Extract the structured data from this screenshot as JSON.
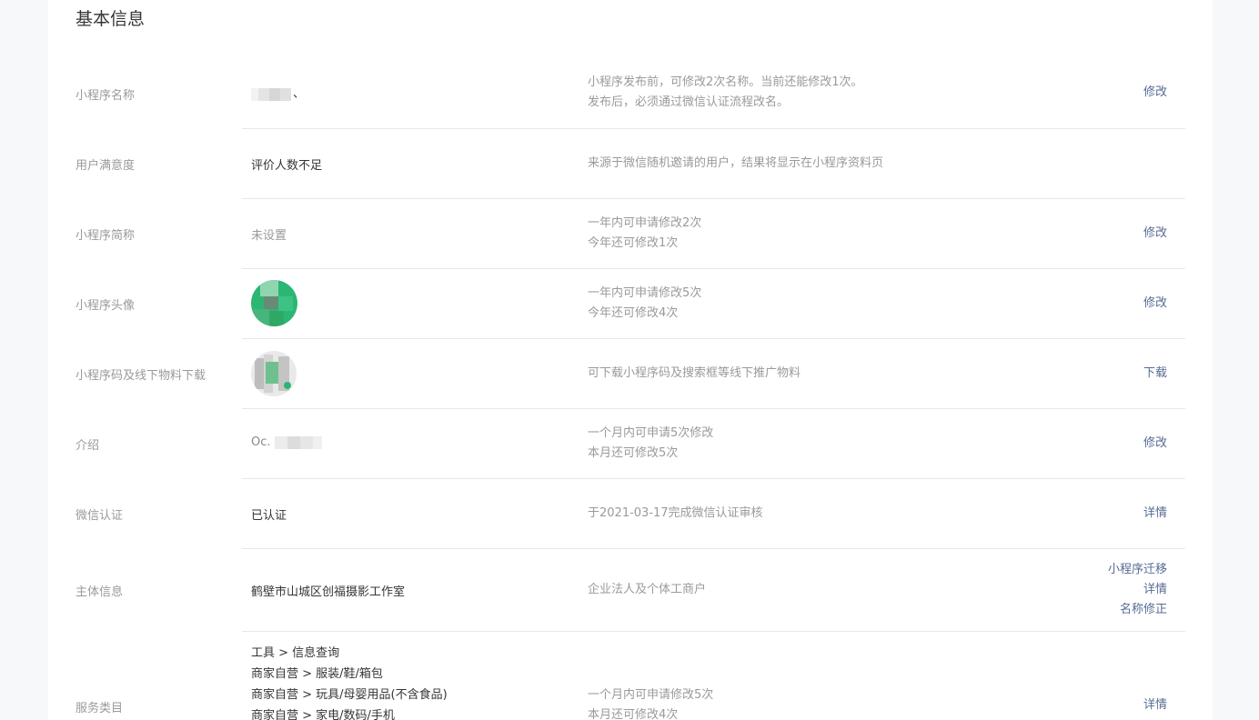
{
  "section_title": "基本信息",
  "rows": {
    "name": {
      "label": "小程序名称",
      "value_suffix": "、",
      "desc": [
        "小程序发布前，可修改2次名称。当前还能修改1次。",
        "发布后，必须通过微信认证流程改名。"
      ],
      "action": "修改"
    },
    "satisfaction": {
      "label": "用户满意度",
      "value": "评价人数不足",
      "desc": [
        "来源于微信随机邀请的用户，结果将显示在小程序资料页"
      ]
    },
    "short_name": {
      "label": "小程序简称",
      "value": "未设置",
      "desc": [
        "一年内可申请修改2次",
        "今年还可修改1次"
      ],
      "action": "修改"
    },
    "avatar": {
      "label": "小程序头像",
      "desc": [
        "一年内可申请修改5次",
        "今年还可修改4次"
      ],
      "action": "修改"
    },
    "qrcode": {
      "label": "小程序码及线下物料下载",
      "desc": [
        "可下载小程序码及搜索框等线下推广物料"
      ],
      "action": "下载"
    },
    "intro": {
      "label": "介绍",
      "value_prefix": "Oc.",
      "desc": [
        "一个月内可申请5次修改",
        "本月还可修改5次"
      ],
      "action": "修改"
    },
    "wechat_verify": {
      "label": "微信认证",
      "value": "已认证",
      "desc": [
        "于2021-03-17完成微信认证审核"
      ],
      "action": "详情"
    },
    "subject": {
      "label": "主体信息",
      "value": "鹤壁市山城区创福摄影工作室",
      "desc": [
        "企业法人及个体工商户"
      ],
      "actions": [
        "小程序迁移",
        "详情",
        "名称修正"
      ]
    },
    "categories": {
      "label": "服务类目",
      "values": [
        "工具 > 信息查询",
        "商家自营 > 服装/鞋/箱包",
        "商家自营 > 玩具/母婴用品(不含食品)",
        "商家自营 > 家电/数码/手机"
      ],
      "desc": [
        "一个月内可申请修改5次",
        "本月还可修改4次"
      ],
      "action": "详情"
    }
  },
  "colors": {
    "link": "#576b95",
    "label": "#9a9a9a",
    "divider": "#e7e7eb",
    "avatar_green": "#2bb673"
  }
}
